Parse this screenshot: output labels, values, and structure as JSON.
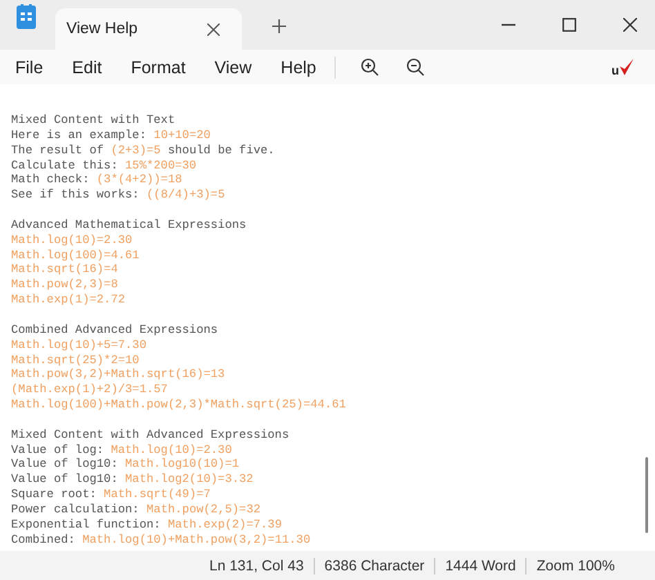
{
  "window": {
    "tabs": [
      {
        "label": "View Help",
        "selected": true
      }
    ]
  },
  "menu": {
    "items": [
      {
        "label": "File"
      },
      {
        "label": "Edit"
      },
      {
        "label": "Format"
      },
      {
        "label": "View"
      },
      {
        "label": "Help"
      }
    ],
    "logo_text": "u"
  },
  "editor": {
    "lines": [
      {
        "kind": "text",
        "text": "Mixed Content with Text"
      },
      {
        "kind": "text",
        "text": "Here is an example: ",
        "formula": "10+10=20"
      },
      {
        "kind": "text",
        "text": "The result of ",
        "formula": "(2+3)=5",
        "after": " should be five."
      },
      {
        "kind": "text",
        "text": "Calculate this: ",
        "formula": "15%*200=30"
      },
      {
        "kind": "text",
        "text": "Math check: ",
        "formula": "(3*(4+2))=18"
      },
      {
        "kind": "text",
        "text": "See if this works: ",
        "formula": "((8/4)+3)=5"
      },
      {
        "kind": "blank"
      },
      {
        "kind": "text",
        "text": "Advanced Mathematical Expressions"
      },
      {
        "kind": "formula",
        "formula": "Math.log(10)=2.30"
      },
      {
        "kind": "formula",
        "formula": "Math.log(100)=4.61"
      },
      {
        "kind": "formula",
        "formula": "Math.sqrt(16)=4"
      },
      {
        "kind": "formula",
        "formula": "Math.pow(2,3)=8"
      },
      {
        "kind": "formula",
        "formula": "Math.exp(1)=2.72"
      },
      {
        "kind": "blank"
      },
      {
        "kind": "text",
        "text": "Combined Advanced Expressions"
      },
      {
        "kind": "formula",
        "formula": "Math.log(10)+5=7.30"
      },
      {
        "kind": "formula",
        "formula": "Math.sqrt(25)*2=10"
      },
      {
        "kind": "formula",
        "formula": "Math.pow(3,2)+Math.sqrt(16)=13"
      },
      {
        "kind": "formula",
        "formula": "(Math.exp(1)+2)/3=1.57"
      },
      {
        "kind": "formula",
        "formula": "Math.log(100)+Math.pow(2,3)*Math.sqrt(25)=44.61"
      },
      {
        "kind": "blank"
      },
      {
        "kind": "text",
        "text": "Mixed Content with Advanced Expressions"
      },
      {
        "kind": "text",
        "text": "Value of log: ",
        "formula": "Math.log(10)=2.30"
      },
      {
        "kind": "text",
        "text": "Value of log10: ",
        "formula": "Math.log10(10)=1"
      },
      {
        "kind": "text",
        "text": "Value of log10: ",
        "formula": "Math.log2(10)=3.32"
      },
      {
        "kind": "text",
        "text": "Square root: ",
        "formula": "Math.sqrt(49)=7"
      },
      {
        "kind": "text",
        "text": "Power calculation: ",
        "formula": "Math.pow(2,5)=32"
      },
      {
        "kind": "text",
        "text": "Exponential function: ",
        "formula": "Math.exp(2)=7.39"
      },
      {
        "kind": "text",
        "text": "Combined: ",
        "formula": "Math.log(10)+Math.pow(3,2)=11.30"
      }
    ]
  },
  "status_bar": {
    "items": [
      "Ln 131, Col 43",
      "6386 Character",
      "1444 Word",
      "Zoom 100%"
    ]
  }
}
